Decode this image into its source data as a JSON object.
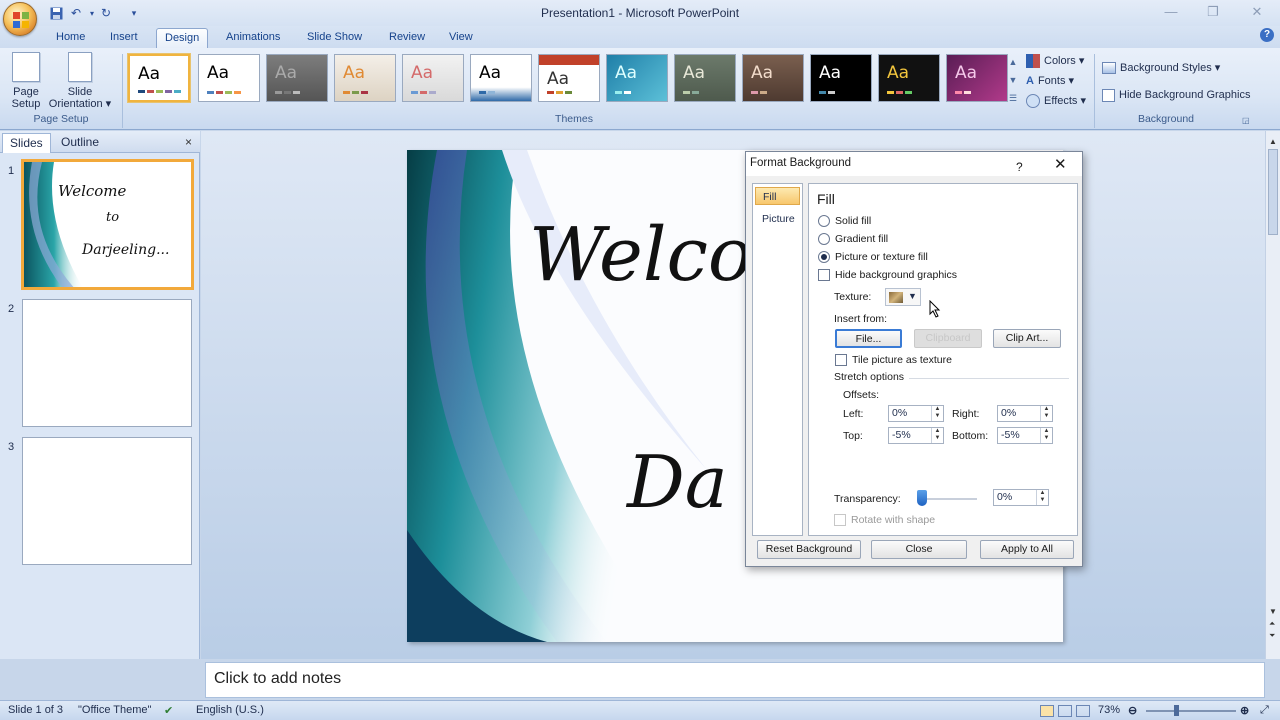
{
  "window": {
    "title": "Presentation1 - Microsoft PowerPoint"
  },
  "tabs": [
    "Home",
    "Insert",
    "Design",
    "Animations",
    "Slide Show",
    "Review",
    "View"
  ],
  "active_tab": "Design",
  "ribbon": {
    "page_setup": {
      "page_setup_label": "Page\nSetup",
      "page_setup_l1": "Page",
      "page_setup_l2": "Setup",
      "orient_l1": "Slide",
      "orient_l2": "Orientation ▾",
      "group": "Page Setup"
    },
    "themes": {
      "group": "Themes",
      "sample": "Aa"
    },
    "colors": "Colors ▾",
    "fonts": "Fonts ▾",
    "effects": "Effects ▾",
    "background": {
      "styles": "Background Styles ▾",
      "hide": "Hide Background Graphics",
      "group": "Background"
    }
  },
  "left_pane": {
    "tabs": [
      "Slides",
      "Outline"
    ],
    "active": "Slides",
    "thumb_nums": [
      "1",
      "2",
      "3"
    ],
    "thumb1": {
      "l1": "Welcome",
      "l2": "to",
      "l3": "Darjeeling..."
    }
  },
  "slide": {
    "l1": "Welcom",
    "l2": "Da"
  },
  "notes": "Click to add notes",
  "status": {
    "slide": "Slide 1 of 3",
    "theme": "\"Office Theme\"",
    "lang": "English (U.S.)",
    "zoom": "73%"
  },
  "dialog": {
    "title": "Format Background",
    "help": "?",
    "nav": [
      "Fill",
      "Picture"
    ],
    "fill_heading": "Fill",
    "solid": "Solid fill",
    "gradient": "Gradient fill",
    "picture": "Picture or texture fill",
    "hide_bg": "Hide background graphics",
    "texture": "Texture:",
    "insert_from": "Insert from:",
    "file_btn": "File...",
    "clipboard_btn": "Clipboard",
    "clipart_btn": "Clip Art...",
    "tile": "Tile picture as texture",
    "stretch": "Stretch options",
    "offsets": "Offsets:",
    "left_label": "Left:",
    "left_val": "0%",
    "right_label": "Right:",
    "right_val": "0%",
    "top_label": "Top:",
    "top_val": "-5%",
    "bottom_label": "Bottom:",
    "bottom_val": "-5%",
    "transparency_label": "Transparency:",
    "transparency_val": "0%",
    "rotate": "Rotate with shape",
    "reset": "Reset Background",
    "close": "Close",
    "apply_all": "Apply to All"
  },
  "colors": {
    "accent_selection": "#f2a93b",
    "ribbon_text": "#15428b"
  }
}
